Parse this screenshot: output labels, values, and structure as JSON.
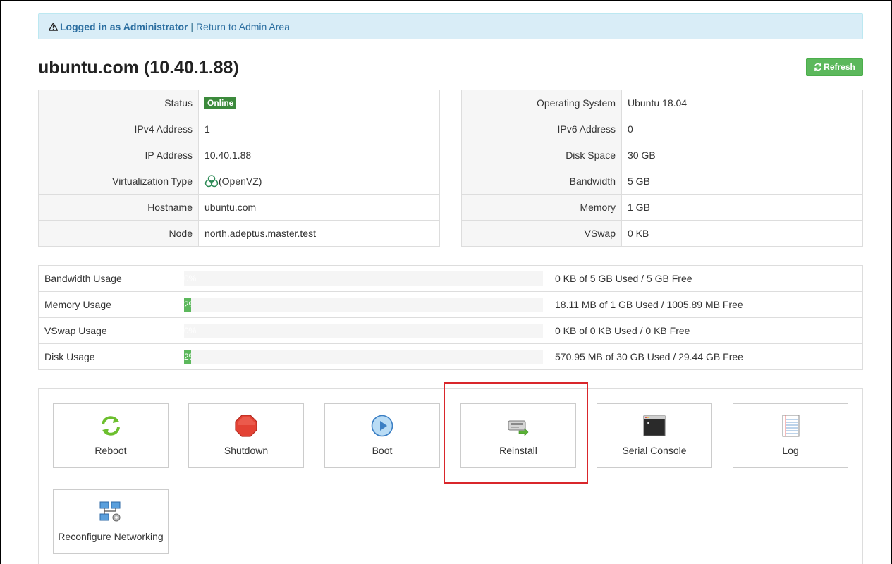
{
  "alert": {
    "logged_in": "Logged in as Administrator",
    "separator": " | ",
    "return_link": "Return to Admin Area"
  },
  "page_title": "ubuntu.com (10.40.1.88)",
  "refresh_label": "Refresh",
  "left_table": [
    {
      "label": "Status",
      "value": "Online",
      "type": "badge"
    },
    {
      "label": "IPv4 Address",
      "value": "1"
    },
    {
      "label": "IP Address",
      "value": "10.40.1.88"
    },
    {
      "label": "Virtualization Type",
      "value": "(OpenVZ)",
      "type": "icon",
      "icon": "openvz-icon"
    },
    {
      "label": "Hostname",
      "value": "ubuntu.com"
    },
    {
      "label": "Node",
      "value": "north.adeptus.master.test"
    }
  ],
  "right_table": [
    {
      "label": "Operating System",
      "value": "Ubuntu 18.04"
    },
    {
      "label": "IPv6 Address",
      "value": "0"
    },
    {
      "label": "Disk Space",
      "value": "30 GB"
    },
    {
      "label": "Bandwidth",
      "value": "5 GB"
    },
    {
      "label": "Memory",
      "value": "1 GB"
    },
    {
      "label": "VSwap",
      "value": "0 KB"
    }
  ],
  "usage": [
    {
      "label": "Bandwidth Usage",
      "percent": 0,
      "percent_label": "0%",
      "detail": "0 KB of 5 GB Used / 5 GB Free"
    },
    {
      "label": "Memory Usage",
      "percent": 2,
      "percent_label": "2%",
      "detail": "18.11 MB of 1 GB Used / 1005.89 MB Free"
    },
    {
      "label": "VSwap Usage",
      "percent": 0,
      "percent_label": "0%",
      "detail": "0 KB of 0 KB Used / 0 KB Free"
    },
    {
      "label": "Disk Usage",
      "percent": 2,
      "percent_label": "2%",
      "detail": "570.95 MB of 30 GB Used / 29.44 GB Free"
    }
  ],
  "actions": {
    "reboot": "Reboot",
    "shutdown": "Shutdown",
    "boot": "Boot",
    "reinstall": "Reinstall",
    "serial_console": "Serial Console",
    "log": "Log",
    "reconfigure_networking": "Reconfigure Networking"
  },
  "colors": {
    "alert_bg": "#d9edf7",
    "success": "#5cb85c",
    "online_badge": "#3c8a3c",
    "highlight": "#d9262b"
  }
}
